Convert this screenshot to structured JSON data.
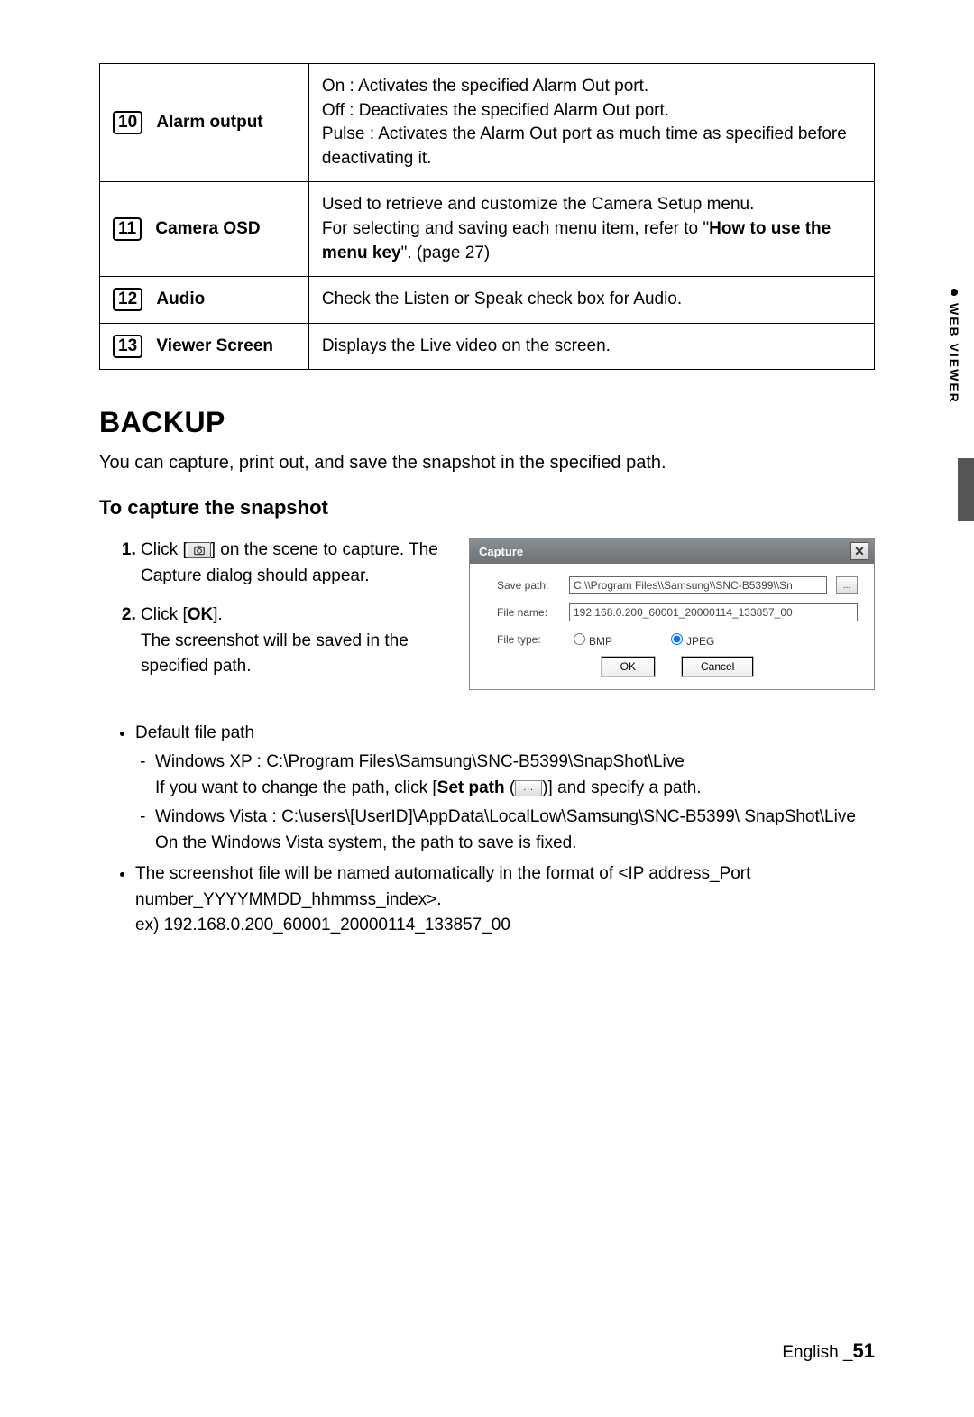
{
  "table": {
    "rows": [
      {
        "num": "10",
        "label": "Alarm output",
        "desc_lines": [
          "On : Activates the specified Alarm Out port.",
          "Off : Deactivates the specified Alarm Out port.",
          "Pulse : Activates the Alarm Out port as much time as specified before deactivating it."
        ]
      },
      {
        "num": "11",
        "label": "Camera OSD",
        "desc_parts": {
          "a": "Used to retrieve and customize the Camera Setup menu.",
          "b": "For selecting and saving each menu item, refer to \"",
          "bold": "How to use the menu key",
          "c": "\". (page 27)"
        }
      },
      {
        "num": "12",
        "label": "Audio",
        "desc_plain": "Check the Listen or Speak check box for Audio."
      },
      {
        "num": "13",
        "label": "Viewer  Screen",
        "desc_plain": "Displays the Live video on the screen."
      }
    ]
  },
  "sections": {
    "backup_heading": "BACKUP",
    "intro": "You can capture, print out, and save the snapshot in the specified path.",
    "subheading": "To capture the snapshot"
  },
  "steps": {
    "s1a": "Click [",
    "s1b": "] on the scene to capture. The Capture dialog should appear.",
    "s2a": "Click [",
    "s2bold": "OK",
    "s2b": "].",
    "s2c": "The screenshot will be saved in the specified path."
  },
  "capture": {
    "title": "Capture",
    "save_path_label": "Save path:",
    "save_path_value": "C:\\\\Program Files\\\\Samsung\\\\SNC-B5399\\\\Sn",
    "browse": "...",
    "file_name_label": "File name:",
    "file_name_value": "192.168.0.200_60001_20000114_133857_00",
    "file_type_label": "File type:",
    "radio_bmp": "BMP",
    "radio_jpeg": "JPEG",
    "ok": "OK",
    "cancel": "Cancel"
  },
  "bullets": {
    "b1": "Default file path",
    "b1a_1": "Windows XP : C:\\Program Files\\Samsung\\SNC-B5399\\SnapShot\\Live",
    "b1a_2a": "If you want to change the path, click [",
    "b1a_2bold": "Set path",
    "b1a_2b": " (",
    "b1a_2c": ")] and specify a path.",
    "b1b_1": "Windows Vista : C:\\users\\[UserID]\\AppData\\LocalLow\\Samsung\\SNC-B5399\\ SnapShot\\Live",
    "b1b_2": "On the Windows Vista system, the path to save is fixed.",
    "b2_1": "The screenshot file will be named automatically in the format of <IP address_Port number_YYYYMMDD_hhmmss_index>.",
    "b2_2": "ex) 192.168.0.200_60001_20000114_133857_00"
  },
  "side": "WEB VIEWER",
  "footer": {
    "lang": "English _",
    "page": "51"
  }
}
